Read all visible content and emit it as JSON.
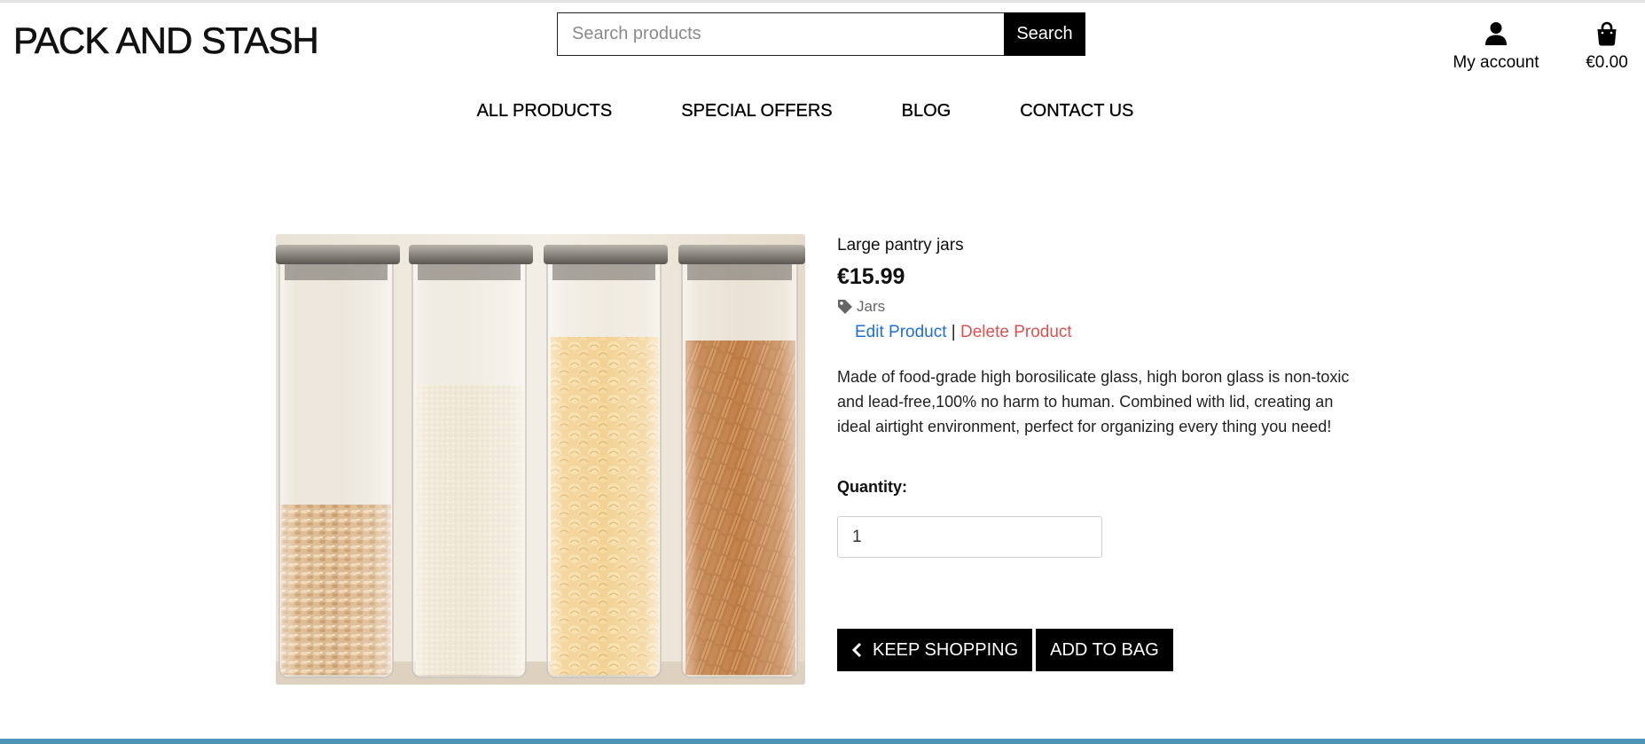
{
  "header": {
    "logo": "PACK AND STASH",
    "search": {
      "placeholder": "Search products",
      "button_label": "Search"
    },
    "account_label": "My account",
    "bag_total": "€0.00"
  },
  "nav": {
    "items": [
      {
        "label": "ALL PRODUCTS"
      },
      {
        "label": "SPECIAL OFFERS"
      },
      {
        "label": "BLOG"
      },
      {
        "label": "CONTACT US"
      }
    ]
  },
  "product": {
    "name": "Large pantry jars",
    "price": "€15.99",
    "category": "Jars",
    "edit_label": "Edit Product",
    "separator": "|",
    "delete_label": "Delete Product",
    "description": "Made of food-grade high borosilicate glass, high boron glass is non-toxic and lead-free,100% no harm to human. Combined with lid, creating an ideal airtight environment, perfect for organizing every thing you need!",
    "quantity_label": "Quantity:",
    "quantity_value": "1"
  },
  "actions": {
    "keep_shopping": "KEEP SHOPPING",
    "add_to_bag": "ADD TO BAG"
  },
  "colors": {
    "edit_link": "#1e6fd8",
    "delete_link": "#d9534f",
    "footer_bar": "#4a93b9"
  }
}
